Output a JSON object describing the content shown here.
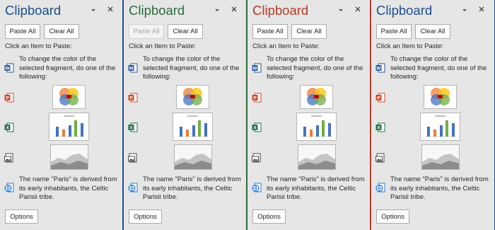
{
  "panes": [
    {
      "accent": "#1e4e8c",
      "title": "Clipboard",
      "paste_all": "Paste All",
      "paste_disabled": false,
      "clear_all": "Clear All",
      "instruction": "Click an Item to Paste:",
      "items": [
        "To change the color of the selected fragment, do one of the following:",
        "The name \"Paris\" is derived from its early inhabitants, the Celtic Parisii tribe."
      ],
      "options": "Options"
    },
    {
      "accent": "#2e6b3c",
      "title": "Clipboard",
      "paste_all": "Paste All",
      "paste_disabled": true,
      "clear_all": "Clear All",
      "instruction": "Click an Item to Paste:",
      "items": [
        "To change the color of the selected fragment, do one of the following:",
        "The name \"Paris\" is derived from its early inhabitants, the Celtic Parisii tribe."
      ],
      "options": "Options"
    },
    {
      "accent": "#b23b2b",
      "title": "Clipboard",
      "paste_all": "Paste All",
      "paste_disabled": false,
      "clear_all": "Clear All",
      "instruction": "Click an Item to Paste:",
      "items": [
        "To change the color of the selected fragment, do one of the following:",
        "The name \"Paris\" is derived from its early inhabitants, the Celtic Parisii tribe."
      ],
      "options": "Options"
    },
    {
      "accent": "#1e4e8c",
      "title": "Clipboard",
      "paste_all": "Paste All",
      "paste_disabled": false,
      "clear_all": "Clear All",
      "instruction": "Click an Item to Paste:",
      "items": [
        "To change the color of the selected fragment, do one of the following:",
        "The name \"Paris\" is derived from its early inhabitants, the Celtic Parisii tribe."
      ],
      "options": "Options"
    }
  ],
  "icons": {
    "pin": "pin-dropdown-icon",
    "close": "close-icon",
    "word": "word-doc-icon",
    "powerpoint": "powerpoint-icon",
    "excel": "excel-icon",
    "picture": "picture-icon",
    "web": "web-page-icon"
  },
  "colors": {
    "word": "#2b579a",
    "powerpoint": "#d24726",
    "excel": "#217346",
    "picture": "#4a4a4a",
    "web": "#2b7cd3",
    "chart_bar_blue": "#4472c4",
    "chart_bar_orange": "#ed7d31",
    "chart_bar_green": "#70ad47"
  }
}
